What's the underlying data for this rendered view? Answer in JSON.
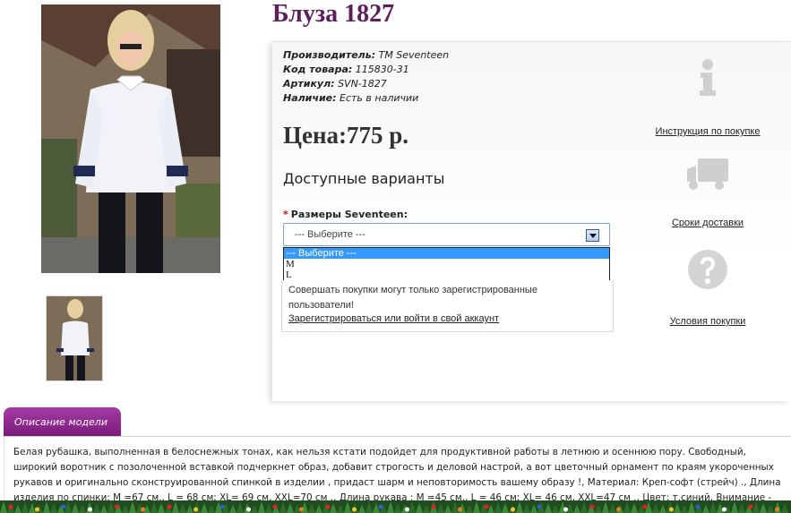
{
  "product": {
    "title": "Блуза 1827",
    "specs": [
      {
        "label": "Производитель:",
        "value": "TM Seventeen"
      },
      {
        "label": "Код товара:",
        "value": "115830-31"
      },
      {
        "label": "Артикул:",
        "value": "SVN-1827"
      },
      {
        "label": "Наличие:",
        "value": "Есть в наличии"
      }
    ],
    "price": "Цена:775 р.",
    "variants_heading": "Доступные варианты",
    "size_label": "Размеры Seventeen:",
    "required_mark": "*",
    "select": {
      "value": "--- Выберите ---",
      "options": [
        "--- Выберите ---",
        "M",
        "L"
      ]
    },
    "notice": "Совершать покупки могут только зарегистрированные пользователи!",
    "register_link": "Зарегистрироваться или войти в свой аккаунт"
  },
  "side_links": [
    {
      "label": "Инструкция по покупке",
      "icon": "info-icon"
    },
    {
      "label": "Сроки доставки",
      "icon": "truck-icon"
    },
    {
      "label": "Условия покупки",
      "icon": "question-icon"
    }
  ],
  "description": {
    "tab_label": "Описание модели",
    "text": "Белая рубашка, выполненная в белоснежных тонах, как нельзя кстати подойдет для продуктивной работы в летнюю и осеннюю пору. Свободный, широкий воротник с позолоченной вставкой подчеркнет образ, добавит строгость и деловой настрой, а вот цветочный орнамент по краям укороченных рукавов и оригинально сконструированной спинкой в изделии , придаст шарм и неповторимость вашему образу !, Материал: Креп-софт (стрейч) ., Длина изделия по спинки: M =67 см., L = 68 см; XL= 69 см, XXL=70 см ., Длина рукава : M =45 см., L = 46 см; XL= 46 см, XXL=47 см ., Цвет: т.синий, Внимание - украшение на"
  },
  "colors": {
    "accent": "#7a1b7a",
    "title": "#5c1f5c",
    "select_highlight": "#3399ff"
  }
}
